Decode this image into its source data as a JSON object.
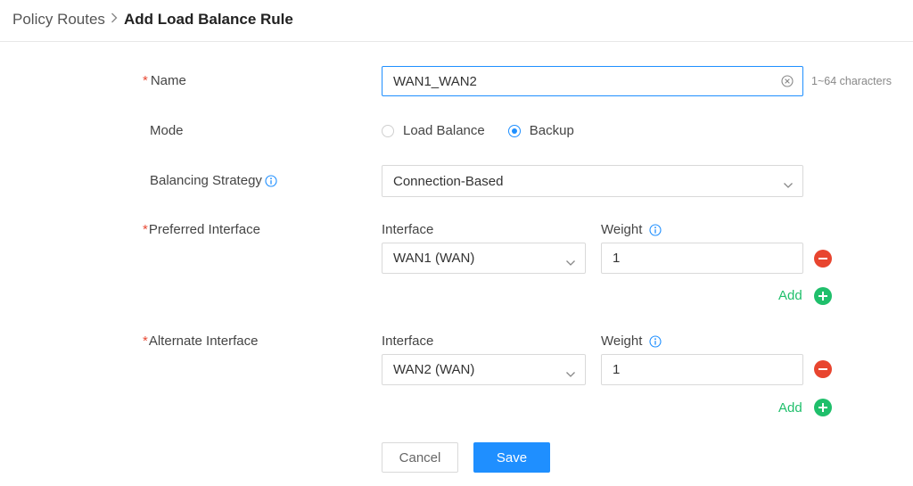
{
  "breadcrumb": {
    "parent": "Policy Routes",
    "separator": ">",
    "current": "Add Load Balance Rule"
  },
  "form": {
    "name": {
      "label": "Name",
      "required_mark": "*",
      "value": "WAN1_WAN2",
      "hint": "1~64 characters"
    },
    "mode": {
      "label": "Mode",
      "options": [
        "Load Balance",
        "Backup"
      ],
      "selected": "Backup"
    },
    "balancing_strategy": {
      "label": "Balancing Strategy",
      "value": "Connection-Based"
    },
    "preferred_interface": {
      "label": "Preferred Interface",
      "required_mark": "*",
      "interface_label": "Interface",
      "weight_label": "Weight",
      "interface_value": "WAN1 (WAN)",
      "weight_value": "1",
      "add_label": "Add"
    },
    "alternate_interface": {
      "label": "Alternate Interface",
      "required_mark": "*",
      "interface_label": "Interface",
      "weight_label": "Weight",
      "interface_value": "WAN2 (WAN)",
      "weight_value": "1",
      "add_label": "Add"
    }
  },
  "actions": {
    "cancel": "Cancel",
    "save": "Save"
  },
  "colors": {
    "accent": "#1f8fff",
    "required": "#e84a35",
    "add": "#1fbf6b",
    "remove": "#e8452f"
  }
}
